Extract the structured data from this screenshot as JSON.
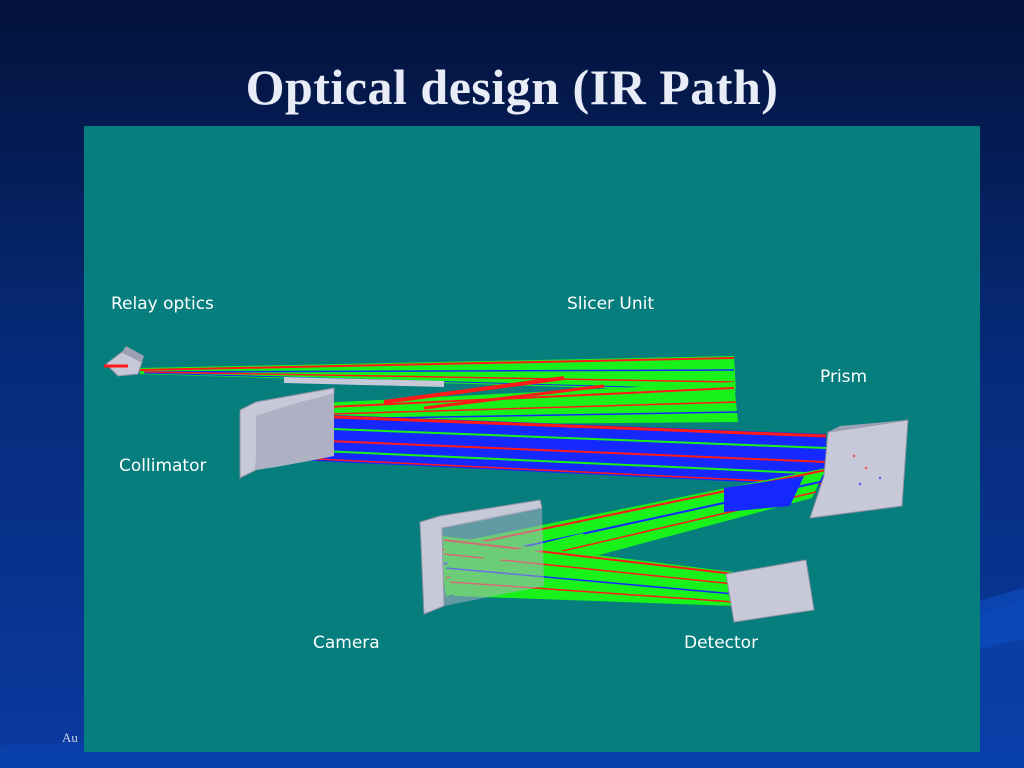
{
  "slide": {
    "title": "Optical design (IR Path)",
    "footer_text": "Au"
  },
  "diagram": {
    "labels": {
      "relay_optics": "Relay optics",
      "slicer_unit": "Slicer Unit",
      "prism": "Prism",
      "collimator": "Collimator",
      "camera": "Camera",
      "detector": "Detector"
    },
    "colors": {
      "panel_bg": "#057e7d",
      "ray_green": "#19f21a",
      "ray_red": "#ff1a1a",
      "ray_blue": "#1428ff",
      "optic_face": "#c8c9d8",
      "optic_edge": "#8e90a3"
    }
  }
}
